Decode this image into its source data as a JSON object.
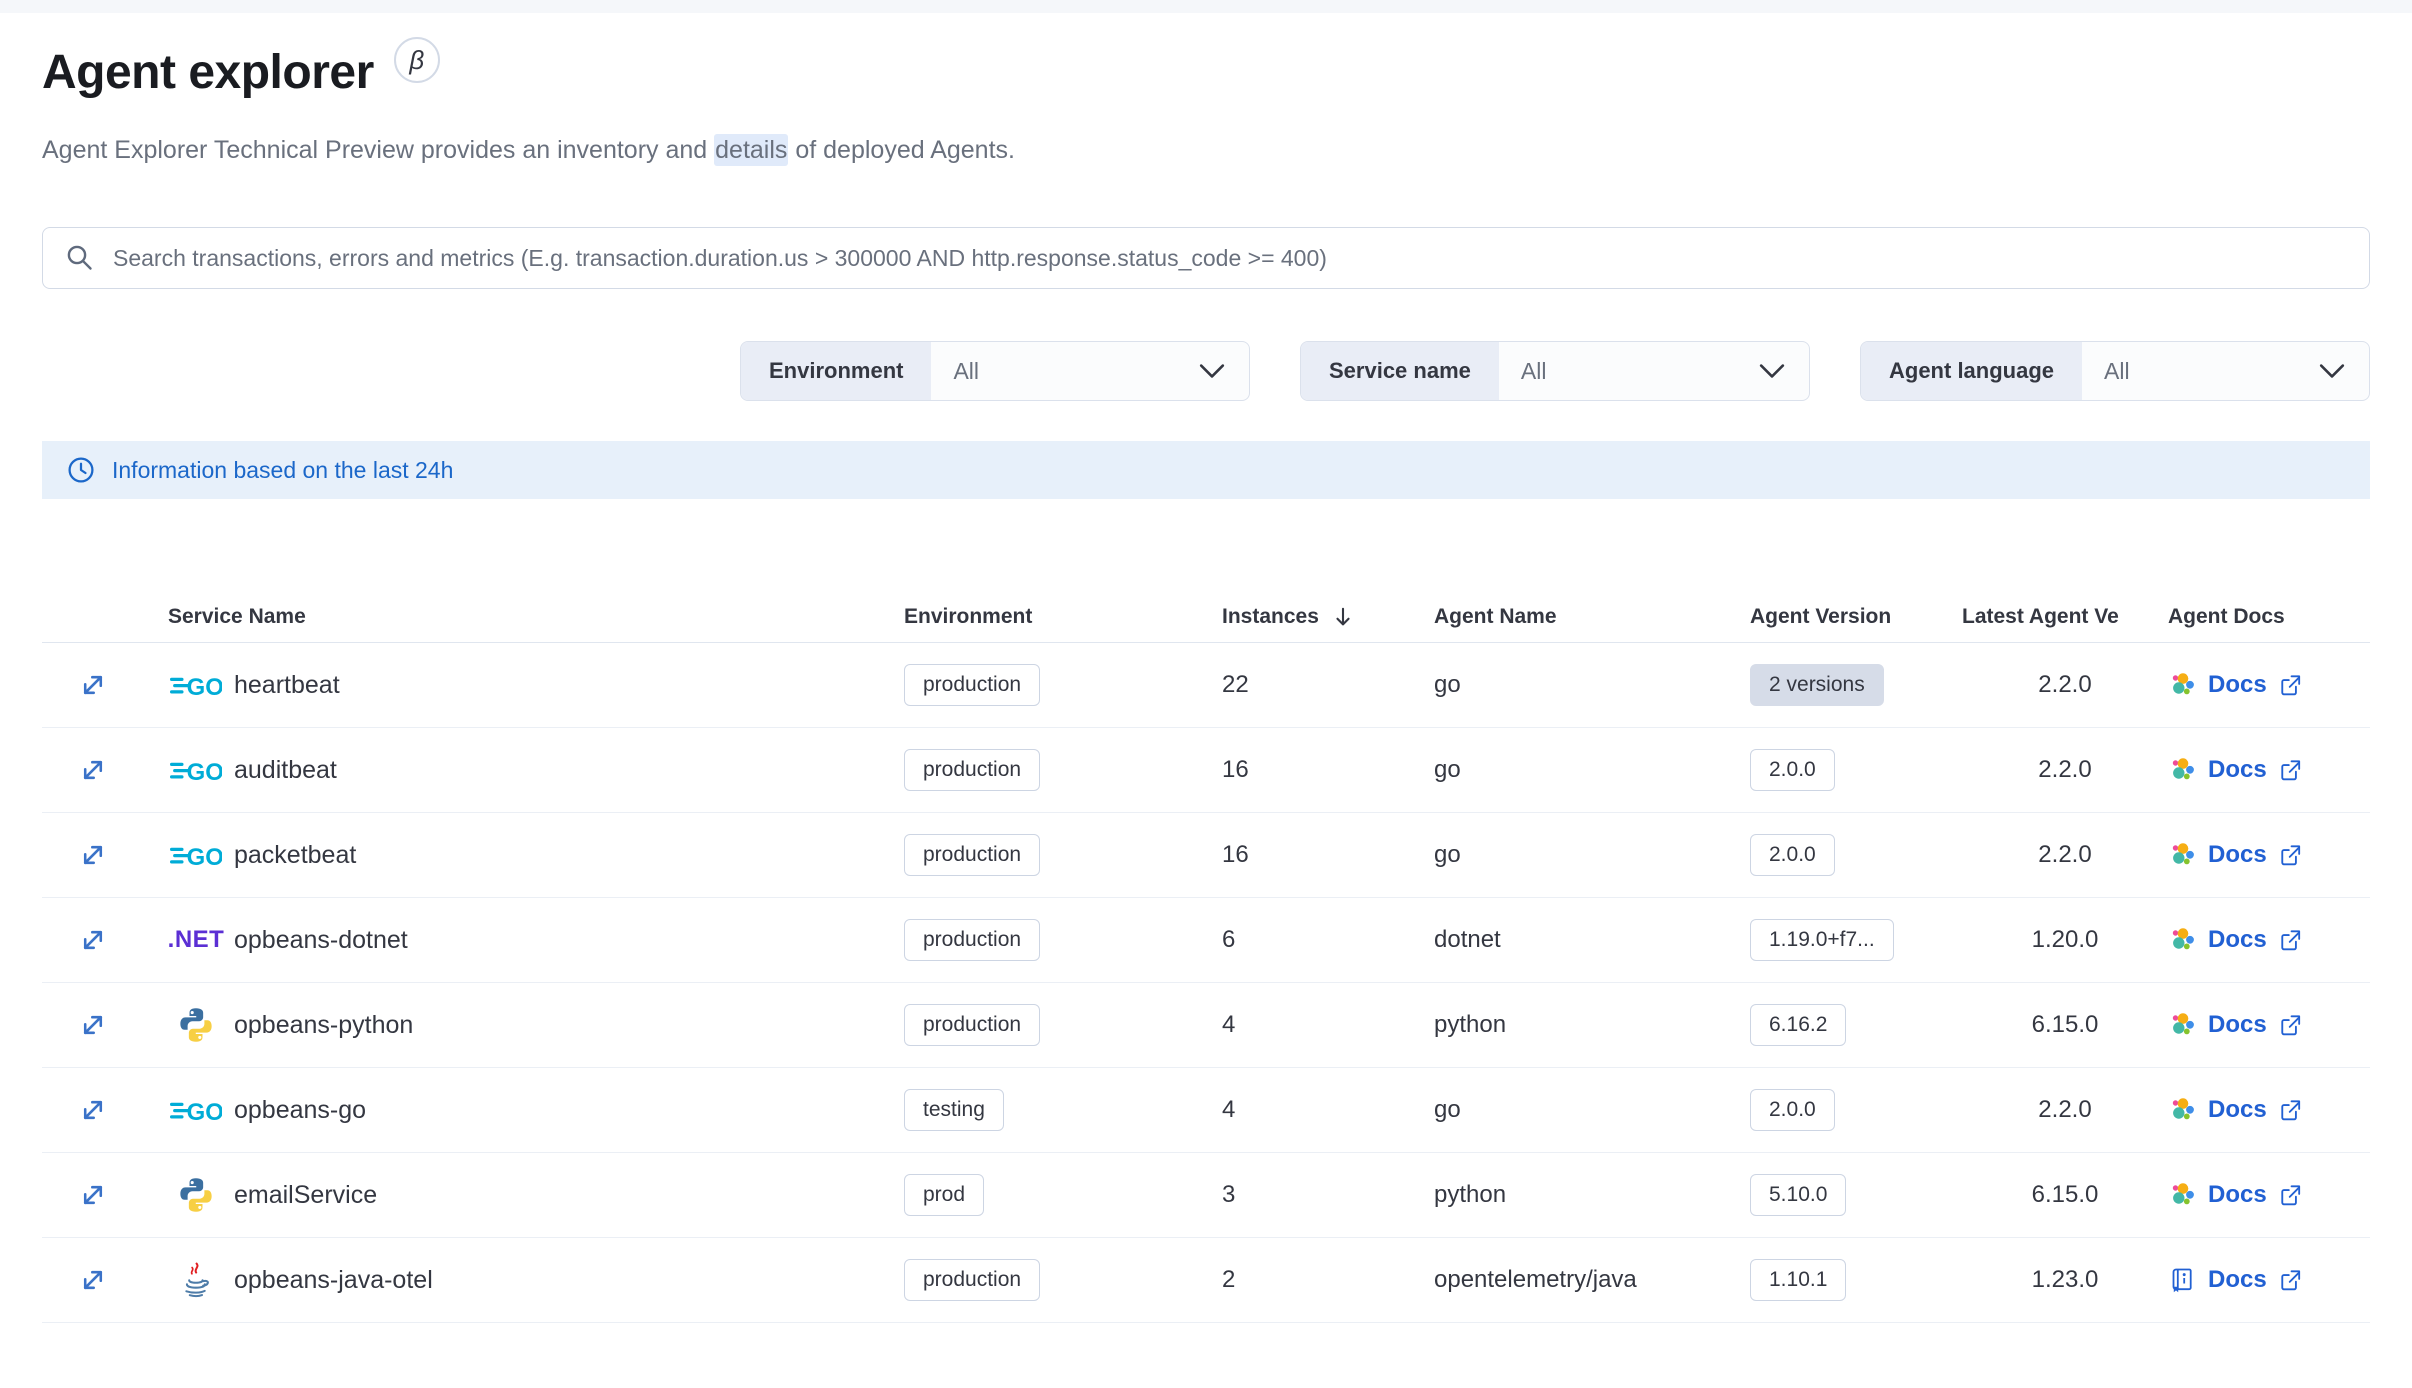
{
  "page": {
    "title": "Agent explorer",
    "beta_symbol": "β",
    "subtitle_pre": "Agent Explorer Technical Preview provides an inventory and ",
    "subtitle_highlight": "details",
    "subtitle_post": " of deployed Agents."
  },
  "search": {
    "placeholder": "Search transactions, errors and metrics (E.g. transaction.duration.us > 300000 AND http.response.status_code >= 400)"
  },
  "filters": {
    "environment": {
      "label": "Environment",
      "value": "All"
    },
    "service_name": {
      "label": "Service name",
      "value": "All"
    },
    "agent_language": {
      "label": "Agent language",
      "value": "All"
    }
  },
  "banner": {
    "text": "Information based on the last 24h"
  },
  "table": {
    "headers": {
      "service_name": "Service Name",
      "environment": "Environment",
      "instances": "Instances",
      "agent_name": "Agent Name",
      "agent_version": "Agent Version",
      "latest_agent_version": "Latest Agent Ve",
      "agent_docs": "Agent Docs"
    },
    "sort": {
      "column": "Instances",
      "direction": "desc"
    },
    "docs_label": "Docs",
    "rows": [
      {
        "service": "heartbeat",
        "language_icon": "go-icon",
        "environment": "production",
        "instances": "22",
        "agent_name": "go",
        "agent_version": "2 versions",
        "version_badge": "filled",
        "latest_agent_version": "2.2.0",
        "docs_icon": "elastic-agent-icon"
      },
      {
        "service": "auditbeat",
        "language_icon": "go-icon",
        "environment": "production",
        "instances": "16",
        "agent_name": "go",
        "agent_version": "2.0.0",
        "version_badge": "hollow",
        "latest_agent_version": "2.2.0",
        "docs_icon": "elastic-agent-icon"
      },
      {
        "service": "packetbeat",
        "language_icon": "go-icon",
        "environment": "production",
        "instances": "16",
        "agent_name": "go",
        "agent_version": "2.0.0",
        "version_badge": "hollow",
        "latest_agent_version": "2.2.0",
        "docs_icon": "elastic-agent-icon"
      },
      {
        "service": "opbeans-dotnet",
        "language_icon": "dotnet-icon",
        "environment": "production",
        "instances": "6",
        "agent_name": "dotnet",
        "agent_version": "1.19.0+f7...",
        "version_badge": "hollow",
        "latest_agent_version": "1.20.0",
        "docs_icon": "elastic-agent-icon"
      },
      {
        "service": "opbeans-python",
        "language_icon": "python-icon",
        "environment": "production",
        "instances": "4",
        "agent_name": "python",
        "agent_version": "6.16.2",
        "version_badge": "hollow",
        "latest_agent_version": "6.15.0",
        "docs_icon": "elastic-agent-icon"
      },
      {
        "service": "opbeans-go",
        "language_icon": "go-icon",
        "environment": "testing",
        "instances": "4",
        "agent_name": "go",
        "agent_version": "2.0.0",
        "version_badge": "hollow",
        "latest_agent_version": "2.2.0",
        "docs_icon": "elastic-agent-icon"
      },
      {
        "service": "emailService",
        "language_icon": "python-icon",
        "environment": "prod",
        "instances": "3",
        "agent_name": "python",
        "agent_version": "5.10.0",
        "version_badge": "hollow",
        "latest_agent_version": "6.15.0",
        "docs_icon": "elastic-agent-icon"
      },
      {
        "service": "opbeans-java-otel",
        "language_icon": "java-icon",
        "environment": "production",
        "instances": "2",
        "agent_name": "opentelemetry/java",
        "agent_version": "1.10.1",
        "version_badge": "hollow",
        "latest_agent_version": "1.23.0",
        "docs_icon": "book-icon"
      }
    ]
  },
  "colors": {
    "link_blue": "#2160d3",
    "banner_bg": "#e7f0fa",
    "banner_text": "#1b67c9",
    "go_brand": "#00acd7",
    "dotnet_brand": "#5b2fd4",
    "badge_border": "#cdd5e3",
    "filled_badge_bg": "#d6dce8",
    "highlight_bg": "#e0eafa"
  }
}
